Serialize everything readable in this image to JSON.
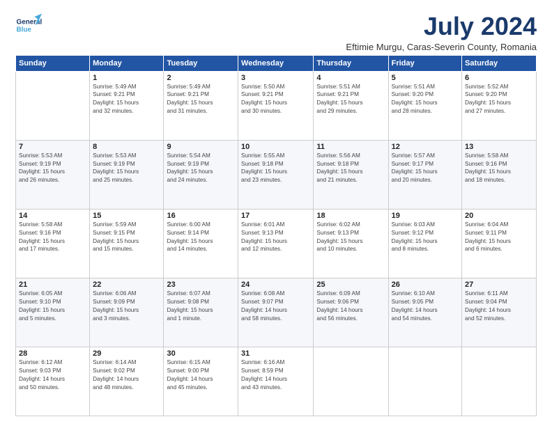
{
  "header": {
    "logo_line1": "General",
    "logo_line2": "Blue",
    "title": "July 2024",
    "subtitle": "Eftimie Murgu, Caras-Severin County, Romania"
  },
  "weekdays": [
    "Sunday",
    "Monday",
    "Tuesday",
    "Wednesday",
    "Thursday",
    "Friday",
    "Saturday"
  ],
  "weeks": [
    [
      {
        "day": "",
        "info": ""
      },
      {
        "day": "1",
        "info": "Sunrise: 5:49 AM\nSunset: 9:21 PM\nDaylight: 15 hours\nand 32 minutes."
      },
      {
        "day": "2",
        "info": "Sunrise: 5:49 AM\nSunset: 9:21 PM\nDaylight: 15 hours\nand 31 minutes."
      },
      {
        "day": "3",
        "info": "Sunrise: 5:50 AM\nSunset: 9:21 PM\nDaylight: 15 hours\nand 30 minutes."
      },
      {
        "day": "4",
        "info": "Sunrise: 5:51 AM\nSunset: 9:21 PM\nDaylight: 15 hours\nand 29 minutes."
      },
      {
        "day": "5",
        "info": "Sunrise: 5:51 AM\nSunset: 9:20 PM\nDaylight: 15 hours\nand 28 minutes."
      },
      {
        "day": "6",
        "info": "Sunrise: 5:52 AM\nSunset: 9:20 PM\nDaylight: 15 hours\nand 27 minutes."
      }
    ],
    [
      {
        "day": "7",
        "info": "Sunrise: 5:53 AM\nSunset: 9:19 PM\nDaylight: 15 hours\nand 26 minutes."
      },
      {
        "day": "8",
        "info": "Sunrise: 5:53 AM\nSunset: 9:19 PM\nDaylight: 15 hours\nand 25 minutes."
      },
      {
        "day": "9",
        "info": "Sunrise: 5:54 AM\nSunset: 9:19 PM\nDaylight: 15 hours\nand 24 minutes."
      },
      {
        "day": "10",
        "info": "Sunrise: 5:55 AM\nSunset: 9:18 PM\nDaylight: 15 hours\nand 23 minutes."
      },
      {
        "day": "11",
        "info": "Sunrise: 5:56 AM\nSunset: 9:18 PM\nDaylight: 15 hours\nand 21 minutes."
      },
      {
        "day": "12",
        "info": "Sunrise: 5:57 AM\nSunset: 9:17 PM\nDaylight: 15 hours\nand 20 minutes."
      },
      {
        "day": "13",
        "info": "Sunrise: 5:58 AM\nSunset: 9:16 PM\nDaylight: 15 hours\nand 18 minutes."
      }
    ],
    [
      {
        "day": "14",
        "info": "Sunrise: 5:58 AM\nSunset: 9:16 PM\nDaylight: 15 hours\nand 17 minutes."
      },
      {
        "day": "15",
        "info": "Sunrise: 5:59 AM\nSunset: 9:15 PM\nDaylight: 15 hours\nand 15 minutes."
      },
      {
        "day": "16",
        "info": "Sunrise: 6:00 AM\nSunset: 9:14 PM\nDaylight: 15 hours\nand 14 minutes."
      },
      {
        "day": "17",
        "info": "Sunrise: 6:01 AM\nSunset: 9:13 PM\nDaylight: 15 hours\nand 12 minutes."
      },
      {
        "day": "18",
        "info": "Sunrise: 6:02 AM\nSunset: 9:13 PM\nDaylight: 15 hours\nand 10 minutes."
      },
      {
        "day": "19",
        "info": "Sunrise: 6:03 AM\nSunset: 9:12 PM\nDaylight: 15 hours\nand 8 minutes."
      },
      {
        "day": "20",
        "info": "Sunrise: 6:04 AM\nSunset: 9:11 PM\nDaylight: 15 hours\nand 6 minutes."
      }
    ],
    [
      {
        "day": "21",
        "info": "Sunrise: 6:05 AM\nSunset: 9:10 PM\nDaylight: 15 hours\nand 5 minutes."
      },
      {
        "day": "22",
        "info": "Sunrise: 6:06 AM\nSunset: 9:09 PM\nDaylight: 15 hours\nand 3 minutes."
      },
      {
        "day": "23",
        "info": "Sunrise: 6:07 AM\nSunset: 9:08 PM\nDaylight: 15 hours\nand 1 minute."
      },
      {
        "day": "24",
        "info": "Sunrise: 6:08 AM\nSunset: 9:07 PM\nDaylight: 14 hours\nand 58 minutes."
      },
      {
        "day": "25",
        "info": "Sunrise: 6:09 AM\nSunset: 9:06 PM\nDaylight: 14 hours\nand 56 minutes."
      },
      {
        "day": "26",
        "info": "Sunrise: 6:10 AM\nSunset: 9:05 PM\nDaylight: 14 hours\nand 54 minutes."
      },
      {
        "day": "27",
        "info": "Sunrise: 6:11 AM\nSunset: 9:04 PM\nDaylight: 14 hours\nand 52 minutes."
      }
    ],
    [
      {
        "day": "28",
        "info": "Sunrise: 6:12 AM\nSunset: 9:03 PM\nDaylight: 14 hours\nand 50 minutes."
      },
      {
        "day": "29",
        "info": "Sunrise: 6:14 AM\nSunset: 9:02 PM\nDaylight: 14 hours\nand 48 minutes."
      },
      {
        "day": "30",
        "info": "Sunrise: 6:15 AM\nSunset: 9:00 PM\nDaylight: 14 hours\nand 45 minutes."
      },
      {
        "day": "31",
        "info": "Sunrise: 6:16 AM\nSunset: 8:59 PM\nDaylight: 14 hours\nand 43 minutes."
      },
      {
        "day": "",
        "info": ""
      },
      {
        "day": "",
        "info": ""
      },
      {
        "day": "",
        "info": ""
      }
    ]
  ]
}
